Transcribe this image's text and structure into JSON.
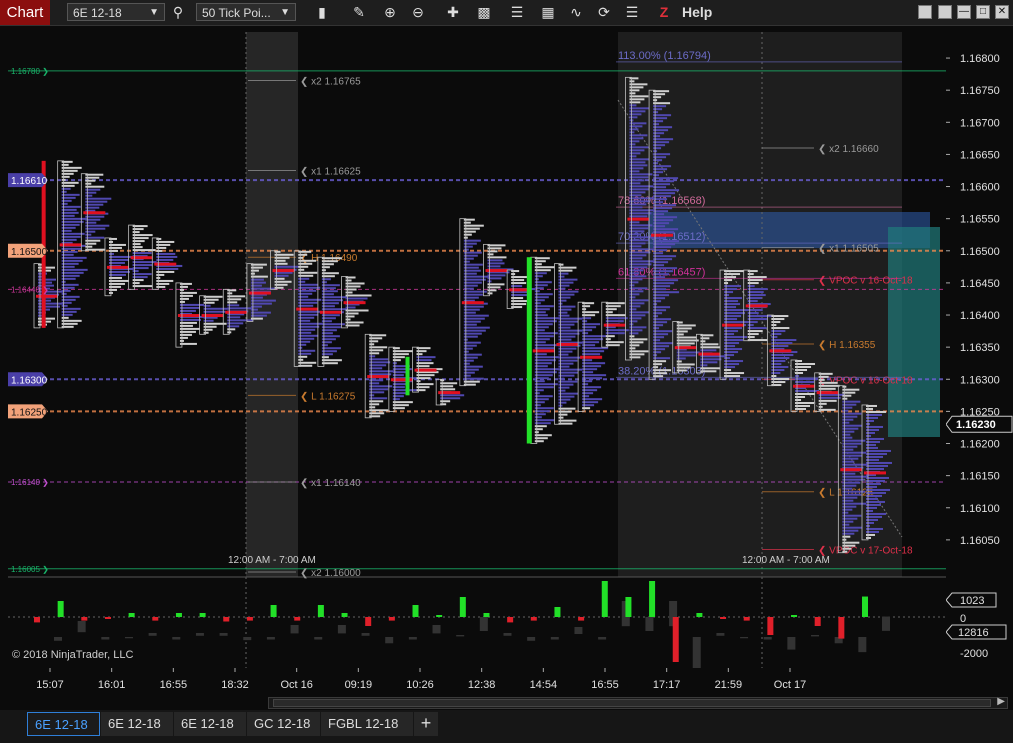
{
  "toolbar": {
    "title": "Chart",
    "instrument": "6E 12-18",
    "bar_type": "50 Tick Poi...",
    "help": "Help",
    "z": "Z"
  },
  "chart_data": {
    "type": "candlestick-volume-profile",
    "instrument": "6E 12-18",
    "price_axis": {
      "ticks": [
        "1.16800",
        "1.16750",
        "1.16700",
        "1.16650",
        "1.16600",
        "1.16550",
        "1.16500",
        "1.16450",
        "1.16400",
        "1.16350",
        "1.16300",
        "1.16250",
        "1.16200",
        "1.16150",
        "1.16100",
        "1.16050"
      ],
      "last_price": "1.16230",
      "range": [
        1.16,
        1.16825
      ]
    },
    "left_price_labels": [
      {
        "text": "1.16780",
        "price": 1.1678,
        "color": "#19b46a"
      },
      {
        "text": "1.16610",
        "price": 1.1661,
        "color": "#6b5fd6"
      },
      {
        "text": "1.16500",
        "price": 1.165,
        "color": "#f08a4e"
      },
      {
        "text": "1.16440",
        "price": 1.1644,
        "color": "#d0379d"
      },
      {
        "text": "1.16300",
        "price": 1.163,
        "color": "#6b5fd6"
      },
      {
        "text": "1.16250",
        "price": 1.1625,
        "color": "#f08a4e"
      },
      {
        "text": "1.16140",
        "price": 1.1614,
        "color": "#c04fcf"
      },
      {
        "text": "1.16005",
        "price": 1.16005,
        "color": "#19b46a"
      }
    ],
    "level_labels": [
      {
        "text": "x2 1.16765",
        "price": 1.16765,
        "from": "0:00",
        "color": "#9a9a9a"
      },
      {
        "text": "x1 1.16625",
        "price": 1.16625,
        "from": "0:00",
        "color": "#9a9a9a"
      },
      {
        "text": "H 1.16490",
        "price": 1.1649,
        "from": "0:00",
        "color": "#c87a2e"
      },
      {
        "text": "L 1.16275",
        "price": 1.16275,
        "from": "0:00",
        "color": "#c87a2e"
      },
      {
        "text": "x1 1.16140",
        "price": 1.1614,
        "from": "0:00",
        "color": "#9a9a9a"
      },
      {
        "text": "x2 1.16000",
        "price": 1.16,
        "from": "0:00",
        "color": "#9a9a9a"
      },
      {
        "text": "x2 1.16660",
        "price": 1.1666,
        "from": "1:00",
        "color": "#9a9a9a"
      },
      {
        "text": "x1 1.16505",
        "price": 1.16505,
        "from": "1:00",
        "color": "#9a9a9a"
      },
      {
        "text": "VPOC v 16-Oct-18",
        "price": 1.16455,
        "from": "1:00",
        "color": "#e0304a"
      },
      {
        "text": "H 1.16355",
        "price": 1.16355,
        "from": "1:00",
        "color": "#c87a2e"
      },
      {
        "text": "VPOC v 16-Oct-18",
        "price": 1.163,
        "from": "1:00",
        "color": "#e0304a"
      },
      {
        "text": "L 1.16125",
        "price": 1.16125,
        "from": "1:00",
        "color": "#c87a2e"
      },
      {
        "text": "VPOC v 17-Oct-18",
        "price": 1.16035,
        "from": "1:00",
        "color": "#e0304a"
      }
    ],
    "fib_levels": [
      {
        "text": "113.00% (1.16794)",
        "price": 1.16794,
        "color": "#6c6cc8"
      },
      {
        "text": "78.60% (1.16568)",
        "price": 1.16568,
        "color": "#d06a9a"
      },
      {
        "text": "70.20% (1.16512)",
        "price": 1.16512,
        "color": "#6c6cc8"
      },
      {
        "text": "61.80% (1.16457)",
        "price": 1.16457,
        "color": "#d0309a"
      },
      {
        "text": "38.20% (1.16303)",
        "price": 1.16303,
        "color": "#6c6cc8"
      }
    ],
    "session_labels": [
      {
        "text": "12:00 AM - 7:00 AM",
        "time": "Oct 16"
      },
      {
        "text": "12:00 AM - 7:00 AM",
        "time": "Oct 17"
      }
    ],
    "watermark": "© 2018 NinjaTrader, LLC",
    "bars": [
      {
        "o": 1.1647,
        "h": 1.1648,
        "l": 1.1638,
        "c": 1.164
      },
      {
        "o": 1.164,
        "h": 1.1664,
        "l": 1.1638,
        "c": 1.166
      },
      {
        "o": 1.166,
        "h": 1.1662,
        "l": 1.165,
        "c": 1.1652
      },
      {
        "o": 1.165,
        "h": 1.1652,
        "l": 1.1643,
        "c": 1.1646
      },
      {
        "o": 1.1646,
        "h": 1.1654,
        "l": 1.1644,
        "c": 1.165
      },
      {
        "o": 1.165,
        "h": 1.1652,
        "l": 1.1644,
        "c": 1.1647
      },
      {
        "o": 1.1642,
        "h": 1.1645,
        "l": 1.1635,
        "c": 1.1639
      },
      {
        "o": 1.1639,
        "h": 1.1643,
        "l": 1.1637,
        "c": 1.1642
      },
      {
        "o": 1.1642,
        "h": 1.1644,
        "l": 1.1637,
        "c": 1.1638
      },
      {
        "o": 1.164,
        "h": 1.1648,
        "l": 1.1639,
        "c": 1.1646
      },
      {
        "o": 1.1646,
        "h": 1.165,
        "l": 1.1644,
        "c": 1.1648
      },
      {
        "o": 1.1646,
        "h": 1.165,
        "l": 1.1632,
        "c": 1.1634
      },
      {
        "o": 1.1634,
        "h": 1.1649,
        "l": 1.1632,
        "c": 1.1646
      },
      {
        "o": 1.1643,
        "h": 1.1646,
        "l": 1.1638,
        "c": 1.1641
      },
      {
        "o": 1.1634,
        "h": 1.1637,
        "l": 1.1624,
        "c": 1.1627
      },
      {
        "o": 1.1627,
        "h": 1.1635,
        "l": 1.1625,
        "c": 1.1633
      },
      {
        "o": 1.1633,
        "h": 1.1635,
        "l": 1.1628,
        "c": 1.1634
      },
      {
        "o": 1.1627,
        "h": 1.163,
        "l": 1.1626,
        "c": 1.1628
      },
      {
        "o": 1.163,
        "h": 1.1655,
        "l": 1.1629,
        "c": 1.1652
      },
      {
        "o": 1.1649,
        "h": 1.1651,
        "l": 1.1643,
        "c": 1.1645
      },
      {
        "o": 1.1645,
        "h": 1.1647,
        "l": 1.1641,
        "c": 1.1643
      },
      {
        "o": 1.1623,
        "h": 1.1649,
        "l": 1.162,
        "c": 1.1647
      },
      {
        "o": 1.1647,
        "h": 1.1648,
        "l": 1.1623,
        "c": 1.1626
      },
      {
        "o": 1.1626,
        "h": 1.1642,
        "l": 1.1625,
        "c": 1.164
      },
      {
        "o": 1.164,
        "h": 1.1642,
        "l": 1.1635,
        "c": 1.1637
      },
      {
        "o": 1.1637,
        "h": 1.1677,
        "l": 1.1633,
        "c": 1.1673
      },
      {
        "o": 1.1673,
        "h": 1.1675,
        "l": 1.163,
        "c": 1.1633
      },
      {
        "o": 1.1633,
        "h": 1.1639,
        "l": 1.1631,
        "c": 1.1635
      },
      {
        "o": 1.1635,
        "h": 1.1637,
        "l": 1.1631,
        "c": 1.1632
      },
      {
        "o": 1.1632,
        "h": 1.1647,
        "l": 1.163,
        "c": 1.1645
      },
      {
        "o": 1.1645,
        "h": 1.1647,
        "l": 1.1636,
        "c": 1.1638
      },
      {
        "o": 1.1638,
        "h": 1.164,
        "l": 1.1629,
        "c": 1.1631
      },
      {
        "o": 1.1631,
        "h": 1.1633,
        "l": 1.1625,
        "c": 1.1628
      },
      {
        "o": 1.1628,
        "h": 1.1631,
        "l": 1.1625,
        "c": 1.1627
      },
      {
        "o": 1.1627,
        "h": 1.1629,
        "l": 1.1603,
        "c": 1.1606
      },
      {
        "o": 1.1606,
        "h": 1.1626,
        "l": 1.1605,
        "c": 1.1625
      }
    ],
    "volume_axis": {
      "ticks": [
        "1023",
        "0",
        "-2000"
      ],
      "marker": "12816"
    },
    "volume": [
      -300,
      800,
      -200,
      -100,
      200,
      -200,
      200,
      200,
      -250,
      -200,
      600,
      -200,
      600,
      200,
      -500,
      -200,
      600,
      100,
      1000,
      200,
      -300,
      -200,
      500,
      -200,
      1800,
      1000,
      1800,
      -2500,
      200,
      -100,
      -200,
      -1000,
      100,
      -500,
      -1200,
      1023
    ],
    "time_axis": [
      "15:07",
      "16:01",
      "16:55",
      "18:32",
      "Oct 16",
      "09:19",
      "10:26",
      "12:38",
      "14:54",
      "16:55",
      "17:17",
      "21:59",
      "Oct 17"
    ]
  },
  "tabs": [
    {
      "label": "6E 12-18",
      "active": true
    },
    {
      "label": "6E 12-18",
      "active": false
    },
    {
      "label": "6E 12-18",
      "active": false
    },
    {
      "label": "GC 12-18",
      "active": false
    },
    {
      "label": "FGBL 12-18",
      "active": false
    }
  ],
  "tab_add": "+"
}
